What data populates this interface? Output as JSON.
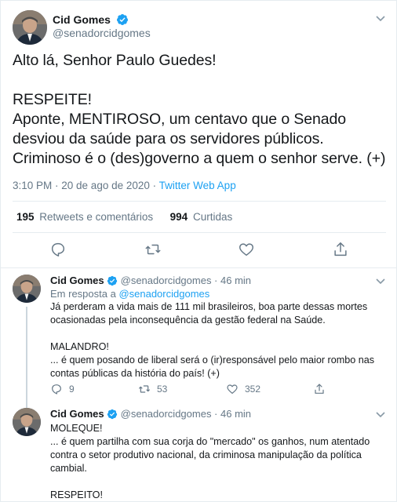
{
  "main_tweet": {
    "author_name": "Cid Gomes",
    "author_handle": "@senadorcidgomes",
    "verified": true,
    "lines": [
      "Alto lá, Senhor Paulo Guedes!",
      "",
      "RESPEITE!",
      "Aponte, MENTIROSO, um centavo que o Senado",
      "desviou da saúde para os servidores públicos.",
      "Criminoso é o (des)governo a quem o senhor serve.  (+)"
    ],
    "timestamp": "3:10 PM · 20 de ago de 2020",
    "separator": " · ",
    "source": "Twitter Web App",
    "retweets_count": "195",
    "retweets_label": "Retweets e comentários",
    "likes_count": "994",
    "likes_label": "Curtidas"
  },
  "replies": [
    {
      "author_name": "Cid Gomes",
      "author_handle": "@senadorcidgomes · 46 min",
      "in_reply_prefix": "Em resposta a ",
      "in_reply_handle": "@senadorcidgomes",
      "lines": [
        "Já perderam a vida mais de 111 mil brasileiros, boa parte dessas mortes",
        "ocasionadas pela inconsequência da gestão federal na Saúde.",
        "",
        "MALANDRO!",
        "... é quem posando de liberal será o (ir)responsável pelo maior rombo nas",
        "contas públicas da história do país! (+)"
      ],
      "reply_count": "9",
      "retweet_count": "53",
      "like_count": "352"
    },
    {
      "author_name": "Cid Gomes",
      "author_handle": "@senadorcidgomes · 46 min",
      "lines": [
        "MOLEQUE!",
        "... é quem partilha com sua corja do \"mercado\" os ganhos, num atentado",
        "contra o setor produtivo nacional, da criminosa manipulação da política",
        "cambial.",
        "",
        "RESPEITO!"
      ]
    }
  ],
  "colors": {
    "text": "#14171a",
    "secondary": "#657786",
    "link": "#1da1f2",
    "border": "#e6ecf0",
    "thread_line": "#ccd6dd"
  },
  "icons": [
    "verified-badge-icon",
    "chevron-down-icon",
    "reply-icon",
    "retweet-icon",
    "like-icon",
    "share-icon"
  ]
}
